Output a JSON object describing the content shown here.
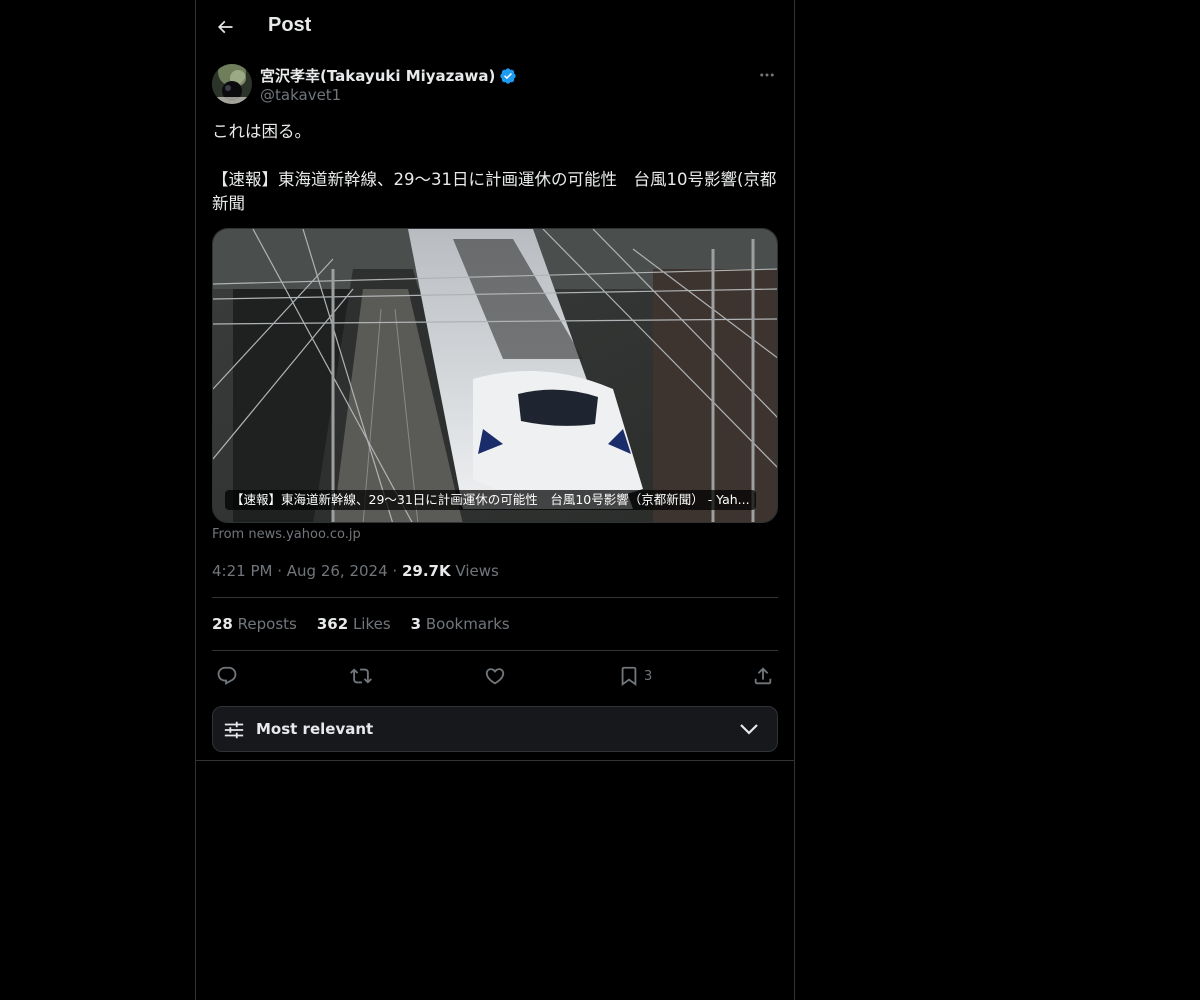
{
  "header": {
    "title": "Post"
  },
  "post": {
    "author_name": "宮沢孝幸(Takayuki Miyazawa)",
    "author_handle": "@takavet1",
    "text": "これは困る。\n\n【速報】東海道新幹線、29〜31日に計画運休の可能性　台風10号影響(京都新聞",
    "card": {
      "caption": "【速報】東海道新幹線、29〜31日に計画運休の可能性　台風10号影響（京都新聞） - Yah...",
      "source": "From news.yahoo.co.jp"
    },
    "time": "4:21 PM",
    "date": "Aug 26, 2024",
    "views_count": "29.7K",
    "views_label": "Views",
    "reposts_count": "28",
    "reposts_label": "Reposts",
    "likes_count": "362",
    "likes_label": "Likes",
    "bookmarks_count": "3",
    "bookmarks_label": "Bookmarks",
    "bookmark_action_count": "3"
  },
  "sort": {
    "label": "Most relevant"
  },
  "colors": {
    "background": "#000000",
    "text_primary": "#e7e9ea",
    "text_secondary": "#71767b",
    "border": "#2f3336",
    "verified": "#1d9bf0"
  },
  "icons": {
    "back": "arrow-left-icon",
    "verified": "verified-badge-icon",
    "more": "more-dots-icon",
    "reply": "reply-icon",
    "repost": "repost-icon",
    "like": "heart-icon",
    "bookmark": "bookmark-icon",
    "share": "share-icon",
    "sort": "sliders-icon",
    "chevron": "chevron-down-icon"
  }
}
